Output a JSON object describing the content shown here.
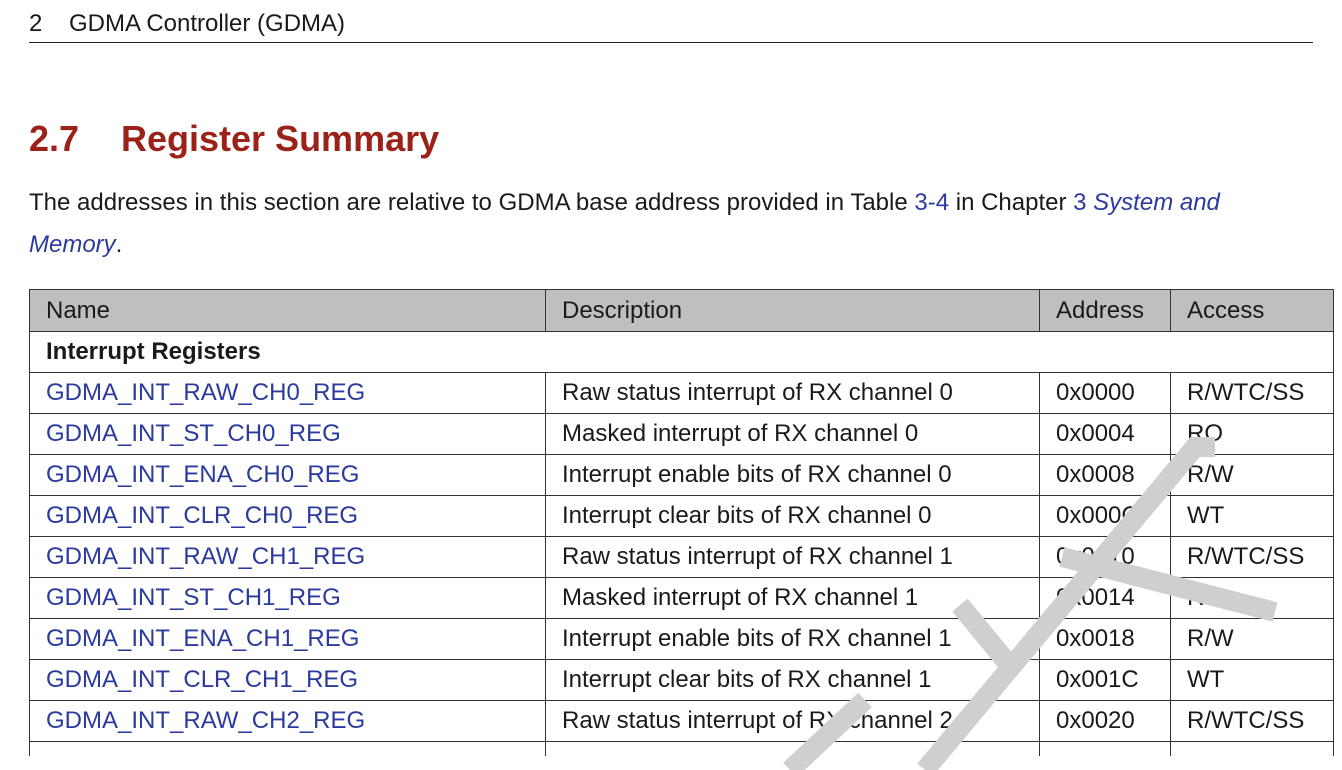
{
  "header": {
    "chapter_number": "2",
    "chapter_title": "GDMA Controller (GDMA)"
  },
  "section": {
    "number": "2.7",
    "title": "Register Summary"
  },
  "intro": {
    "text_1": "The addresses in this section are relative to GDMA base address provided in Table ",
    "table_ref": "3-4",
    "text_2": " in Chapter ",
    "chapter_ref": "3",
    "chapter_ref_title": "System and Memory",
    "text_3": "."
  },
  "table": {
    "columns": [
      "Name",
      "Description",
      "Address",
      "Access"
    ],
    "group_label": "Interrupt Registers",
    "rows": [
      {
        "name": "GDMA_INT_RAW_CH0_REG",
        "description": "Raw status interrupt of RX channel 0",
        "address": "0x0000",
        "access": "R/WTC/SS"
      },
      {
        "name": "GDMA_INT_ST_CH0_REG",
        "description": "Masked interrupt of RX channel 0",
        "address": "0x0004",
        "access": "RO"
      },
      {
        "name": "GDMA_INT_ENA_CH0_REG",
        "description": "Interrupt enable bits of RX channel 0",
        "address": "0x0008",
        "access": "R/W"
      },
      {
        "name": "GDMA_INT_CLR_CH0_REG",
        "description": "Interrupt clear bits of RX channel 0",
        "address": "0x000C",
        "access": "WT"
      },
      {
        "name": "GDMA_INT_RAW_CH1_REG",
        "description": "Raw status interrupt of RX channel 1",
        "address": "0x0010",
        "access": "R/WTC/SS"
      },
      {
        "name": "GDMA_INT_ST_CH1_REG",
        "description": "Masked interrupt of RX channel 1",
        "address": "0x0014",
        "access": "RO"
      },
      {
        "name": "GDMA_INT_ENA_CH1_REG",
        "description": "Interrupt enable bits of RX channel 1",
        "address": "0x0018",
        "access": "R/W"
      },
      {
        "name": "GDMA_INT_CLR_CH1_REG",
        "description": "Interrupt clear bits of RX channel 1",
        "address": "0x001C",
        "access": "WT"
      },
      {
        "name": "GDMA_INT_RAW_CH2_REG",
        "description": "Raw status interrupt of RX channel 2",
        "address": "0x0020",
        "access": "R/WTC/SS"
      }
    ]
  },
  "colors": {
    "title_red": "#9b2219",
    "link_blue": "#2b3a9e",
    "header_gray": "#bfbfbf"
  }
}
